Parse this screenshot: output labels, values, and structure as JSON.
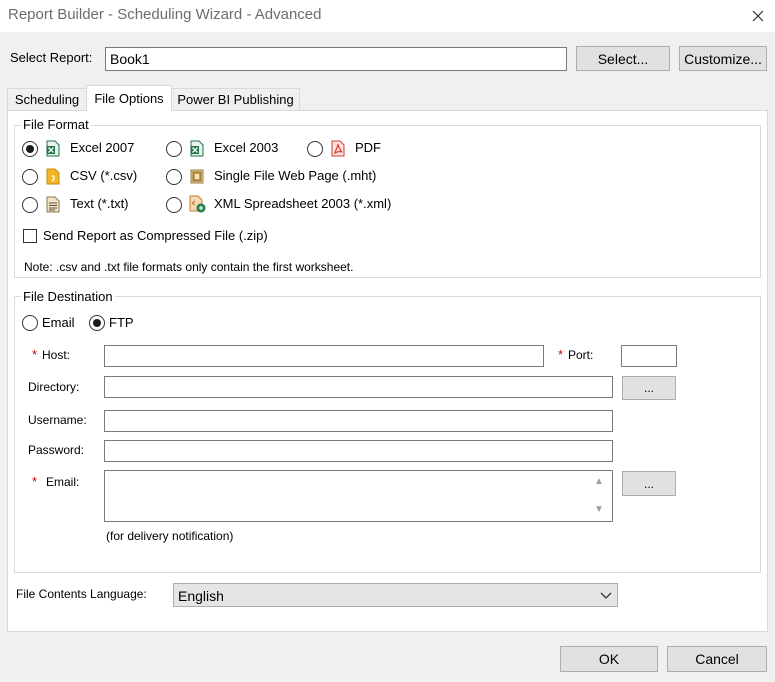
{
  "window": {
    "title": "Report Builder - Scheduling Wizard - Advanced"
  },
  "select_report": {
    "label": "Select Report:",
    "value": "Book1",
    "select_button": "Select...",
    "customize_button": "Customize..."
  },
  "tabs": [
    {
      "label": "Scheduling",
      "active": false
    },
    {
      "label": "File Options",
      "active": true
    },
    {
      "label": "Power BI Publishing",
      "active": false
    }
  ],
  "file_format": {
    "legend": "File Format",
    "options": {
      "excel2007": {
        "label": "Excel 2007",
        "selected": true,
        "icon": "excel-icon"
      },
      "excel2003": {
        "label": "Excel 2003",
        "selected": false,
        "icon": "excel-icon"
      },
      "pdf": {
        "label": "PDF",
        "selected": false,
        "icon": "pdf-icon"
      },
      "csv": {
        "label": "CSV (*.csv)",
        "selected": false,
        "icon": "csv-file-icon"
      },
      "mht": {
        "label": "Single File Web Page (.mht)",
        "selected": false,
        "icon": "web-page-icon"
      },
      "txt": {
        "label": "Text (*.txt)",
        "selected": false,
        "icon": "text-file-icon"
      },
      "xml": {
        "label": "XML Spreadsheet 2003 (*.xml)",
        "selected": false,
        "icon": "xml-spreadsheet-icon"
      }
    },
    "compressed_label": "Send Report as Compressed File (.zip)",
    "compressed_checked": false,
    "note": "Note: .csv and .txt file formats only contain the first worksheet."
  },
  "file_destination": {
    "legend": "File Destination",
    "email_option": "Email",
    "ftp_option": "FTP",
    "selected": "FTP",
    "required_mark": "*",
    "host_label": "Host:",
    "host_value": "",
    "port_label": "Port:",
    "port_value": "",
    "directory_label": "Directory:",
    "directory_value": "",
    "browse_label": "...",
    "username_label": "Username:",
    "username_value": "",
    "password_label": "Password:",
    "password_value": "",
    "email_label": "Email:",
    "email_value": "",
    "email_browse_label": "...",
    "email_hint": "(for delivery notification)"
  },
  "language": {
    "label": "File Contents Language:",
    "value": "English"
  },
  "footer": {
    "ok": "OK",
    "cancel": "Cancel"
  },
  "colors": {
    "excel": "#217346",
    "pdf": "#d83b2b",
    "csv": "#e8a317",
    "required": "#d00000"
  }
}
